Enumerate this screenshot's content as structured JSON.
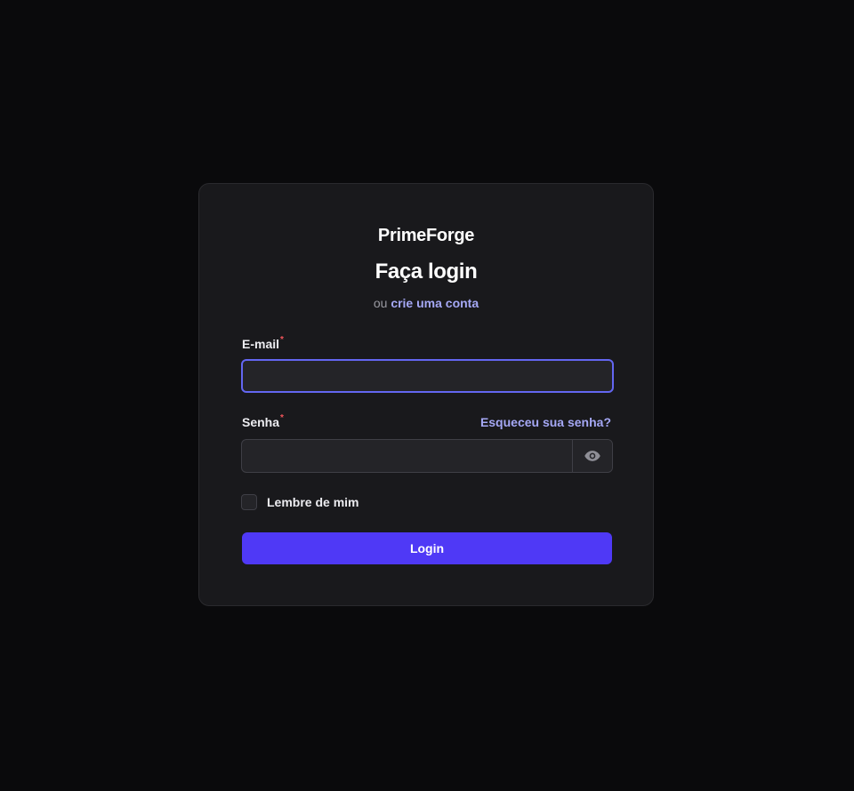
{
  "brand": "PrimeForge",
  "title": "Faça login",
  "subtitle": {
    "prefix": "ou",
    "link": "crie uma conta"
  },
  "email": {
    "label": "E-mail",
    "required_mark": "*",
    "value": "",
    "placeholder": ""
  },
  "password": {
    "label": "Senha",
    "required_mark": "*",
    "forgot_link": "Esqueceu sua senha?",
    "value": "",
    "placeholder": "",
    "toggle_icon": "eye-icon"
  },
  "remember": {
    "label": "Lembre de mim",
    "checked": false
  },
  "submit": {
    "label": "Login"
  },
  "colors": {
    "background": "#0a0a0c",
    "card": "#19191c",
    "accent": "#4f39f6",
    "focus_border": "#6366f1",
    "link": "#a5a8f5",
    "required": "#f2555a"
  }
}
